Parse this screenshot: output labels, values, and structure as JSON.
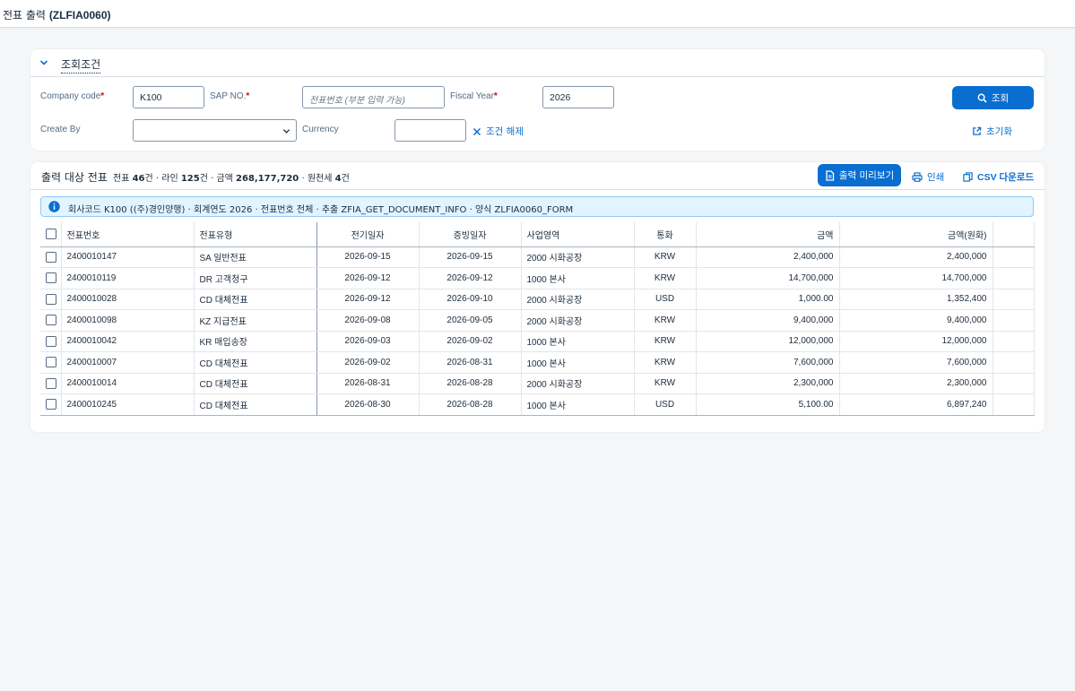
{
  "app": {
    "title_prefix": "전표 출력",
    "title_code": "(ZLFIA0060)"
  },
  "filter": {
    "section_title": "조회조건",
    "company_code": {
      "label": "Company code",
      "value": "K100"
    },
    "sap_no": {
      "label": "SAP NO.",
      "placeholder": "전표번호 (부분 입력 가능)"
    },
    "fiscal_year": {
      "label": "Fiscal Year",
      "value": "2026"
    },
    "create_by": {
      "label": "Create By",
      "value": ""
    },
    "currency": {
      "label": "Currency",
      "value": ""
    },
    "clear_label": "조건 해제",
    "search_label": "조회",
    "reset_label": "초기화",
    "required_mark": "*"
  },
  "result": {
    "title": "출력 대상 전표",
    "summary": {
      "p1": "전표 ",
      "docs": "46",
      "p2": "건 · 라인 ",
      "lines": "125",
      "p3": "건 · 금액 ",
      "amount": "268,177,720",
      "p4": " · 원천세 ",
      "wht": "4",
      "p5": "건"
    },
    "preview_label": "출력 미리보기",
    "print_label": "인쇄",
    "csv_label": "CSV 다운로드",
    "info_text": "회사코드 K100 ((주)경인양행) · 회계연도 2026 · 전표번호 전체 · 추출 ZFIA_GET_DOCUMENT_INFO · 양식 ZLFIA0060_FORM",
    "columns": [
      "전표번호",
      "전표유형",
      "전기일자",
      "증빙일자",
      "사업영역",
      "통화",
      "금액",
      "금액(원화)"
    ],
    "rows": [
      {
        "doc": "2400010147",
        "type": "SA 일반전표",
        "post": "2026-09-15",
        "evid": "2026-09-15",
        "area": "2000 시화공장",
        "cur": "KRW",
        "amt": "2,400,000",
        "krw": "2,400,000"
      },
      {
        "doc": "2400010119",
        "type": "DR 고객청구",
        "post": "2026-09-12",
        "evid": "2026-09-12",
        "area": "1000 본사",
        "cur": "KRW",
        "amt": "14,700,000",
        "krw": "14,700,000"
      },
      {
        "doc": "2400010028",
        "type": "CD 대체전표",
        "post": "2026-09-12",
        "evid": "2026-09-10",
        "area": "2000 시화공장",
        "cur": "USD",
        "amt": "1,000.00",
        "krw": "1,352,400"
      },
      {
        "doc": "2400010098",
        "type": "KZ 지급전표",
        "post": "2026-09-08",
        "evid": "2026-09-05",
        "area": "2000 시화공장",
        "cur": "KRW",
        "amt": "9,400,000",
        "krw": "9,400,000"
      },
      {
        "doc": "2400010042",
        "type": "KR 매입송장",
        "post": "2026-09-03",
        "evid": "2026-09-02",
        "area": "1000 본사",
        "cur": "KRW",
        "amt": "12,000,000",
        "krw": "12,000,000"
      },
      {
        "doc": "2400010007",
        "type": "CD 대체전표",
        "post": "2026-09-02",
        "evid": "2026-08-31",
        "area": "1000 본사",
        "cur": "KRW",
        "amt": "7,600,000",
        "krw": "7,600,000"
      },
      {
        "doc": "2400010014",
        "type": "CD 대체전표",
        "post": "2026-08-31",
        "evid": "2026-08-28",
        "area": "2000 시화공장",
        "cur": "KRW",
        "amt": "2,300,000",
        "krw": "2,300,000"
      },
      {
        "doc": "2400010245",
        "type": "CD 대체전표",
        "post": "2026-08-30",
        "evid": "2026-08-28",
        "area": "1000 본사",
        "cur": "USD",
        "amt": "5,100.00",
        "krw": "6,897,240"
      }
    ]
  },
  "icons": {
    "section_toggle": "chevron-down-icon",
    "search": "search-icon",
    "clear": "close-icon",
    "reset": "external-link-icon",
    "preview": "document-icon",
    "print": "printer-icon",
    "csv": "copy-icon",
    "info": "info-icon"
  },
  "colors": {
    "accent": "#0a6ed1",
    "required": "#e00000",
    "info_bg": "#e1f4ff"
  }
}
